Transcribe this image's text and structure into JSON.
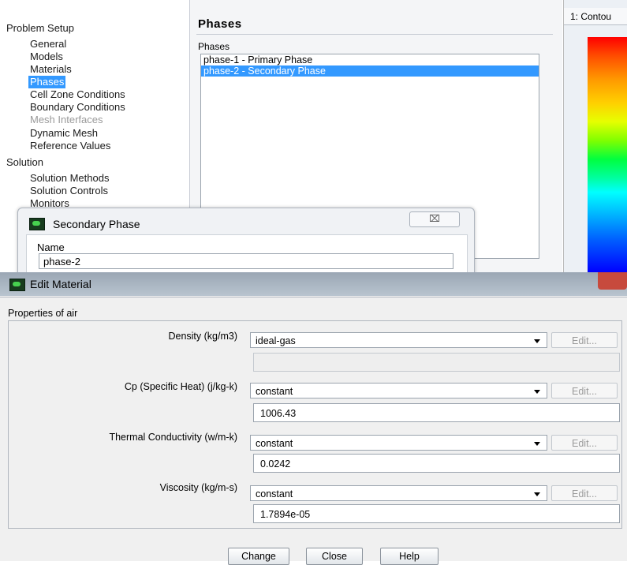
{
  "tree": {
    "problem_setup": "Problem Setup",
    "items": [
      "General",
      "Models",
      "Materials",
      "Phases",
      "Cell Zone Conditions",
      "Boundary Conditions",
      "Mesh Interfaces",
      "Dynamic Mesh",
      "Reference Values"
    ],
    "solution": "Solution",
    "solution_items": [
      "Solution Methods",
      "Solution Controls",
      "Monitors"
    ]
  },
  "phases_panel": {
    "title": "Phases",
    "list_label": "Phases",
    "list": [
      "phase-1 - Primary Phase",
      "phase-2 - Secondary Phase"
    ]
  },
  "contour": {
    "tab": "1: Contou"
  },
  "secondary_phase": {
    "title": "Secondary Phase",
    "close_glyph": "⌧",
    "name_label": "Name",
    "name_value": "phase-2"
  },
  "edit_material": {
    "title": "Edit Material",
    "properties_title": "Properties of air",
    "properties": [
      {
        "label": "Density (kg/m3)",
        "method": "ideal-gas",
        "edit": "Edit...",
        "value": ""
      },
      {
        "label": "Cp (Specific Heat) (j/kg-k)",
        "method": "constant",
        "edit": "Edit...",
        "value": "1006.43"
      },
      {
        "label": "Thermal Conductivity (w/m-k)",
        "method": "constant",
        "edit": "Edit...",
        "value": "0.0242"
      },
      {
        "label": "Viscosity (kg/m-s)",
        "method": "constant",
        "edit": "Edit...",
        "value": "1.7894e-05"
      }
    ],
    "buttons": {
      "change": "Change",
      "close": "Close",
      "help": "Help"
    }
  }
}
